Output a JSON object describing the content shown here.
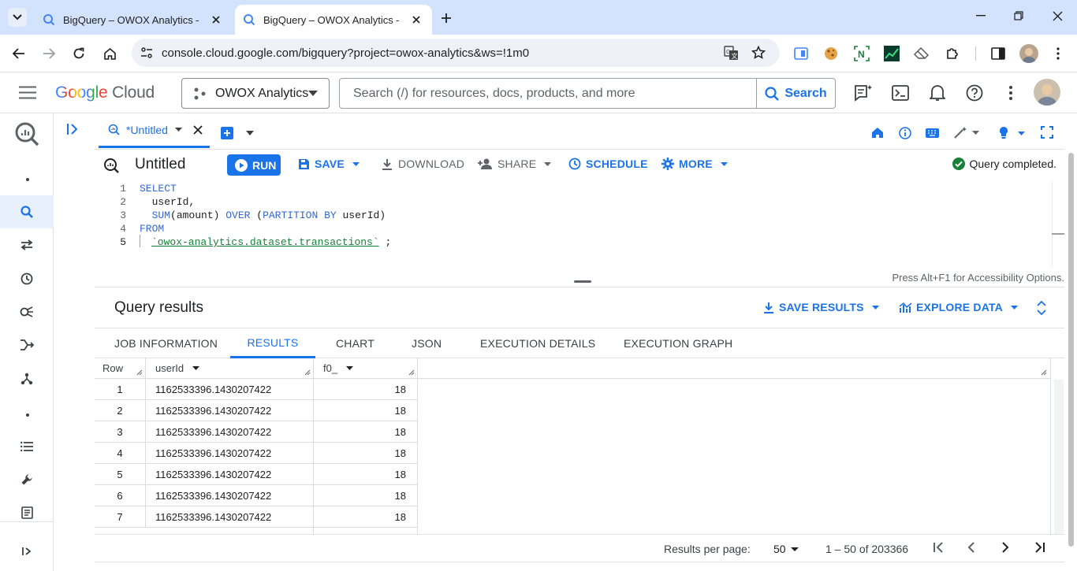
{
  "browser": {
    "tabs": [
      {
        "title": "BigQuery – OWOX Analytics – C"
      },
      {
        "title": "BigQuery – OWOX Analytics – C"
      }
    ],
    "url": "console.cloud.google.com/bigquery?project=owox-analytics&ws=!1m0"
  },
  "header": {
    "logo_google": "Google",
    "logo_cloud": "Cloud",
    "project": "OWOX Analytics",
    "search_placeholder": "Search (/) for resources, docs, products, and more",
    "search_button": "Search"
  },
  "editor_tab": {
    "label": "*Untitled"
  },
  "toolbar": {
    "title": "Untitled",
    "run": "RUN",
    "save": "SAVE",
    "download": "DOWNLOAD",
    "share": "SHARE",
    "schedule": "SCHEDULE",
    "more": "MORE",
    "status": "Query completed."
  },
  "editor": {
    "line_numbers": [
      "1",
      "2",
      "3",
      "4",
      "5"
    ],
    "line1": "SELECT",
    "line2": "  userId,",
    "line3_fn": "  SUM",
    "line3_rest": "(amount) ",
    "line3_over": "OVER",
    "line3_paren": " (",
    "line3_pb": "PARTITION BY",
    "line3_end": " userId)",
    "line4": "FROM",
    "line5_table": "`owox-analytics.dataset.transactions`",
    "line5_end": " ;",
    "accessibility_hint": "Press Alt+F1 for Accessibility Options."
  },
  "results": {
    "title": "Query results",
    "save_results": "SAVE RESULTS",
    "explore_data": "EXPLORE DATA",
    "tabs": [
      "JOB INFORMATION",
      "RESULTS",
      "CHART",
      "JSON",
      "EXECUTION DETAILS",
      "EXECUTION GRAPH"
    ],
    "columns": [
      "Row",
      "userId",
      "f0_"
    ],
    "rows": [
      {
        "row": "1",
        "userId": "1162533396.1430207422",
        "f0": "18"
      },
      {
        "row": "2",
        "userId": "1162533396.1430207422",
        "f0": "18"
      },
      {
        "row": "3",
        "userId": "1162533396.1430207422",
        "f0": "18"
      },
      {
        "row": "4",
        "userId": "1162533396.1430207422",
        "f0": "18"
      },
      {
        "row": "5",
        "userId": "1162533396.1430207422",
        "f0": "18"
      },
      {
        "row": "6",
        "userId": "1162533396.1430207422",
        "f0": "18"
      },
      {
        "row": "7",
        "userId": "1162533396.1430207422",
        "f0": "18"
      }
    ]
  },
  "pager": {
    "per_page_label": "Results per page:",
    "per_page": "50",
    "range": "1 – 50 of 203366"
  },
  "colors": {
    "accent": "#1a73e8",
    "success": "#188038",
    "tabbar": "#d3e3fd"
  }
}
